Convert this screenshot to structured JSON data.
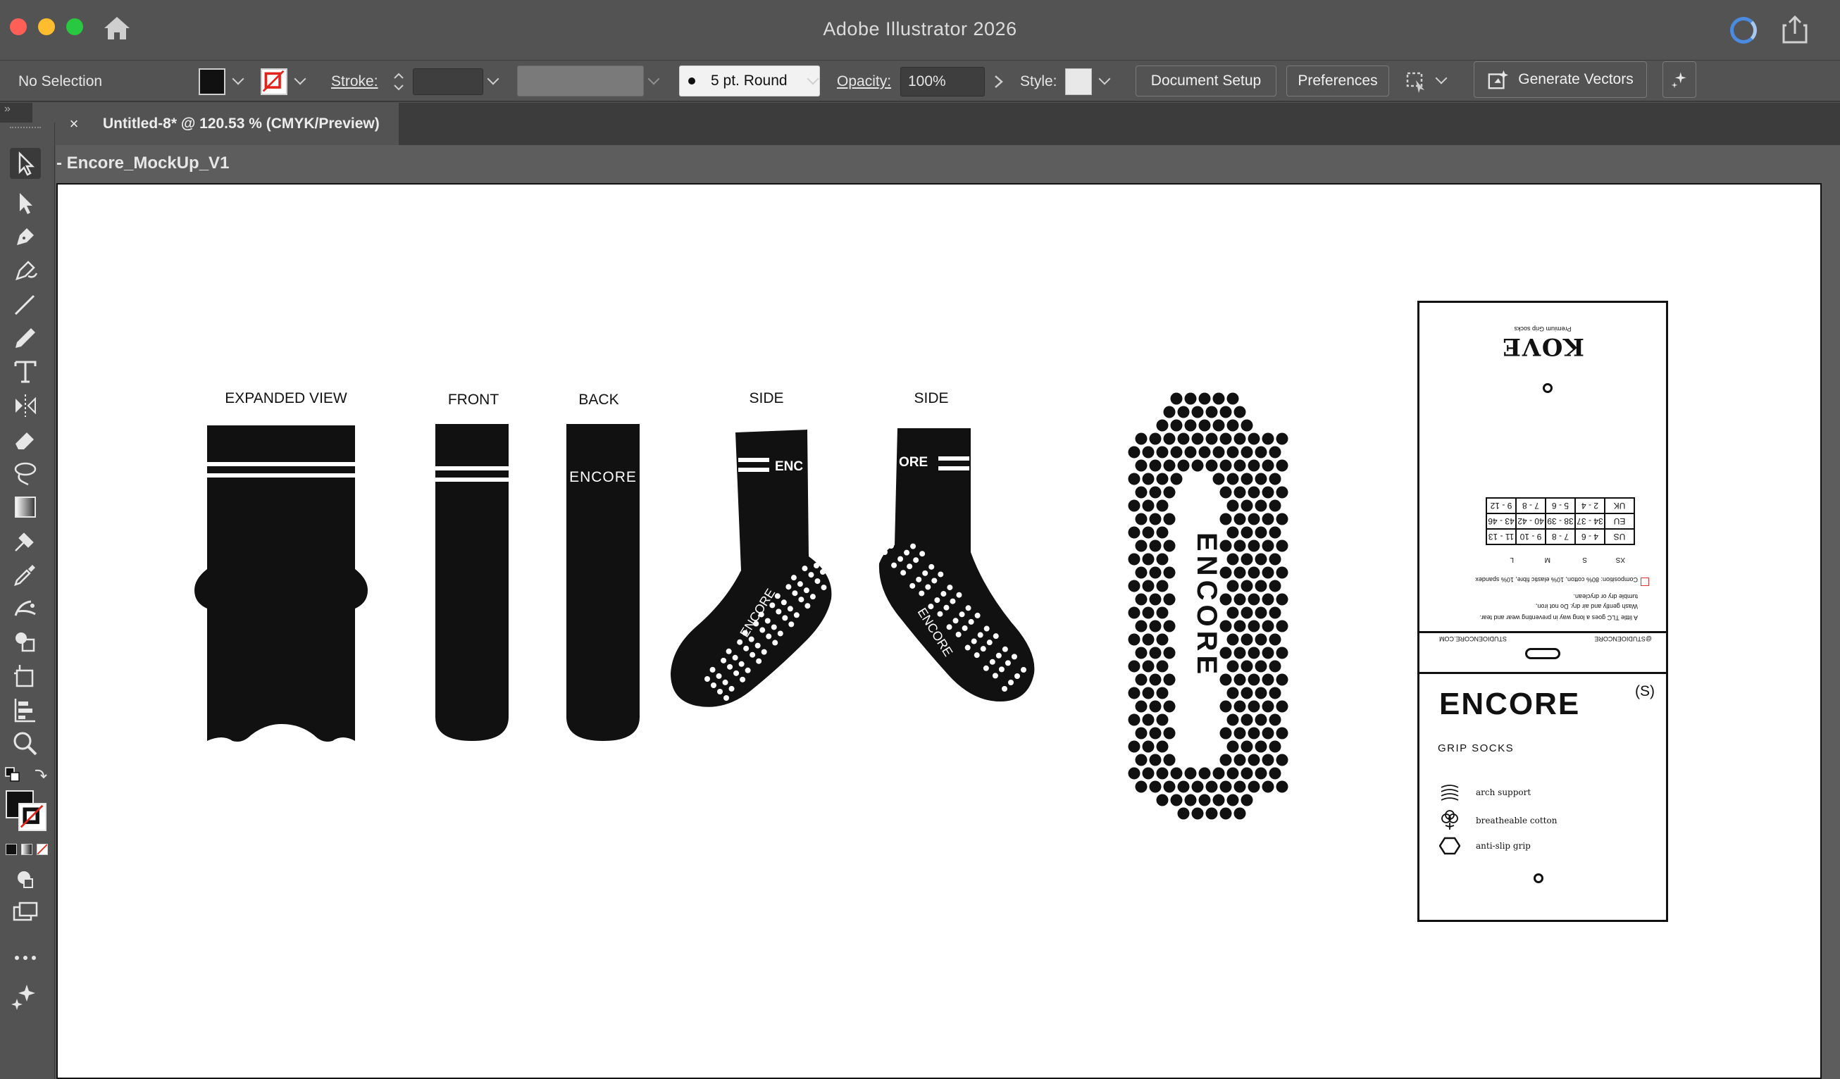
{
  "window": {
    "title": "Adobe Illustrator 2026"
  },
  "control_bar": {
    "selection": "No Selection",
    "stroke_label": "Stroke:",
    "brush": "5 pt. Round",
    "opacity_label": "Opacity:",
    "opacity_value": "100%",
    "style_label": "Style:",
    "document_setup": "Document Setup",
    "preferences": "Preferences",
    "generate_vectors": "Generate Vectors",
    "colors": {
      "fill": "#111111",
      "stroke_none": "#e0231b"
    }
  },
  "tab": {
    "close": "×",
    "title": "Untitled-8* @ 120.53 % (CMYK/Preview)"
  },
  "panel_collapse": "»",
  "artboard": {
    "name": "- Encore_MockUp_V1",
    "views": {
      "expanded": "EXPANDED VIEW",
      "front": "FRONT",
      "back": "BACK",
      "side_left": "SIDE",
      "side_right": "SIDE"
    },
    "brand_text": {
      "back": "ENCORE",
      "side_left_cuff": "ENC",
      "side_right_cuff": "ORE",
      "sole_left": "ENCORE",
      "sole_right": "ENCORE",
      "footbed": "ENCORE"
    }
  },
  "tag": {
    "brand": "ENCORE",
    "size": "(S)",
    "subtitle": "GRIP SOCKS",
    "features": [
      "arch support",
      "breatheable cotton",
      "anti-slip grip"
    ],
    "back_side": {
      "brand": "KOVE",
      "premium": "Premium Grip socks",
      "size_headers": [
        "XS",
        "S",
        "M",
        "L"
      ],
      "size_rows": [
        [
          "US",
          "4 - 6",
          "7 - 8",
          "9 - 10",
          "11 - 13"
        ],
        [
          "EU",
          "34 - 37",
          "38 - 39",
          "40 - 42",
          "43 - 46"
        ],
        [
          "UK",
          "2 - 4",
          "5 - 6",
          "7 - 8",
          "9 - 12"
        ]
      ],
      "composition": "Composition: 80% cotton, 10% elastic fibre, 10% spandex",
      "care_1": "A little TLC goes a long way in preventing wear and tear.",
      "care_2": "Wash gently and air dry. Do not iron,",
      "care_3": "tumble dry or dryclean.",
      "handle_left": "@STUDIOENCORE",
      "handle_right": "STUDIOENCORE.COM"
    }
  }
}
